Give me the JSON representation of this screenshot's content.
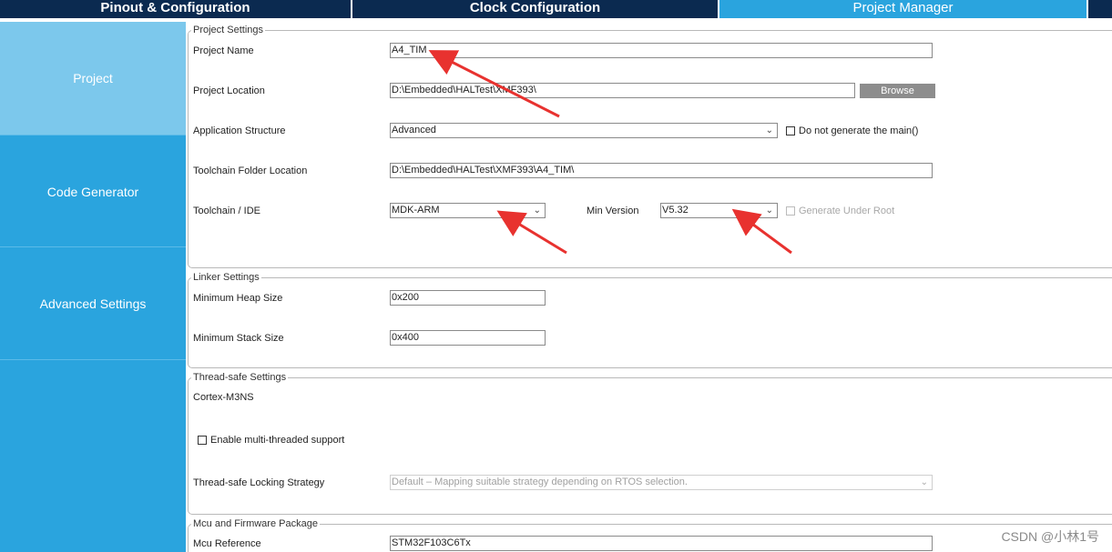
{
  "tabs": [
    {
      "label": "Pinout & Configuration"
    },
    {
      "label": "Clock Configuration"
    },
    {
      "label": "Project Manager"
    }
  ],
  "sidebar": {
    "items": [
      {
        "label": "Project"
      },
      {
        "label": "Code Generator"
      },
      {
        "label": "Advanced Settings"
      }
    ]
  },
  "project_settings": {
    "legend": "Project Settings",
    "project_name": {
      "label": "Project Name",
      "value": "A4_TIM"
    },
    "project_location": {
      "label": "Project Location",
      "value": "D:\\Embedded\\HALTest\\XMF393\\",
      "browse_label": "Browse"
    },
    "application_structure": {
      "label": "Application Structure",
      "value": "Advanced",
      "checkbox_label": "Do not generate the main()"
    },
    "toolchain_folder": {
      "label": "Toolchain Folder Location",
      "value": "D:\\Embedded\\HALTest\\XMF393\\A4_TIM\\"
    },
    "toolchain_ide": {
      "label": "Toolchain / IDE",
      "value": "MDK-ARM"
    },
    "min_version": {
      "label": "Min Version",
      "value": "V5.32"
    },
    "generate_under_root": {
      "label": "Generate Under Root"
    }
  },
  "linker_settings": {
    "legend": "Linker Settings",
    "heap": {
      "label": "Minimum Heap Size",
      "value": "0x200"
    },
    "stack": {
      "label": "Minimum Stack Size",
      "value": "0x400"
    }
  },
  "thread_safe": {
    "legend": "Thread-safe Settings",
    "core": "Cortex-M3NS",
    "multi_thread_label": "Enable multi-threaded support",
    "strategy": {
      "label": "Thread-safe Locking Strategy",
      "value": "Default  –  Mapping suitable strategy depending on RTOS selection."
    }
  },
  "mcu_package": {
    "legend": "Mcu and Firmware Package",
    "mcu_reference": {
      "label": "Mcu Reference",
      "value": "STM32F103C6Tx"
    }
  },
  "watermark": "CSDN @小林1号",
  "colors": {
    "nav_dark": "#0b2a50",
    "accent": "#2aa4de",
    "active": "#7cc8ec",
    "annotation": "#e8322f"
  },
  "icons": {
    "dropdown": "chevron-down-icon",
    "checkbox": "checkbox-icon"
  }
}
